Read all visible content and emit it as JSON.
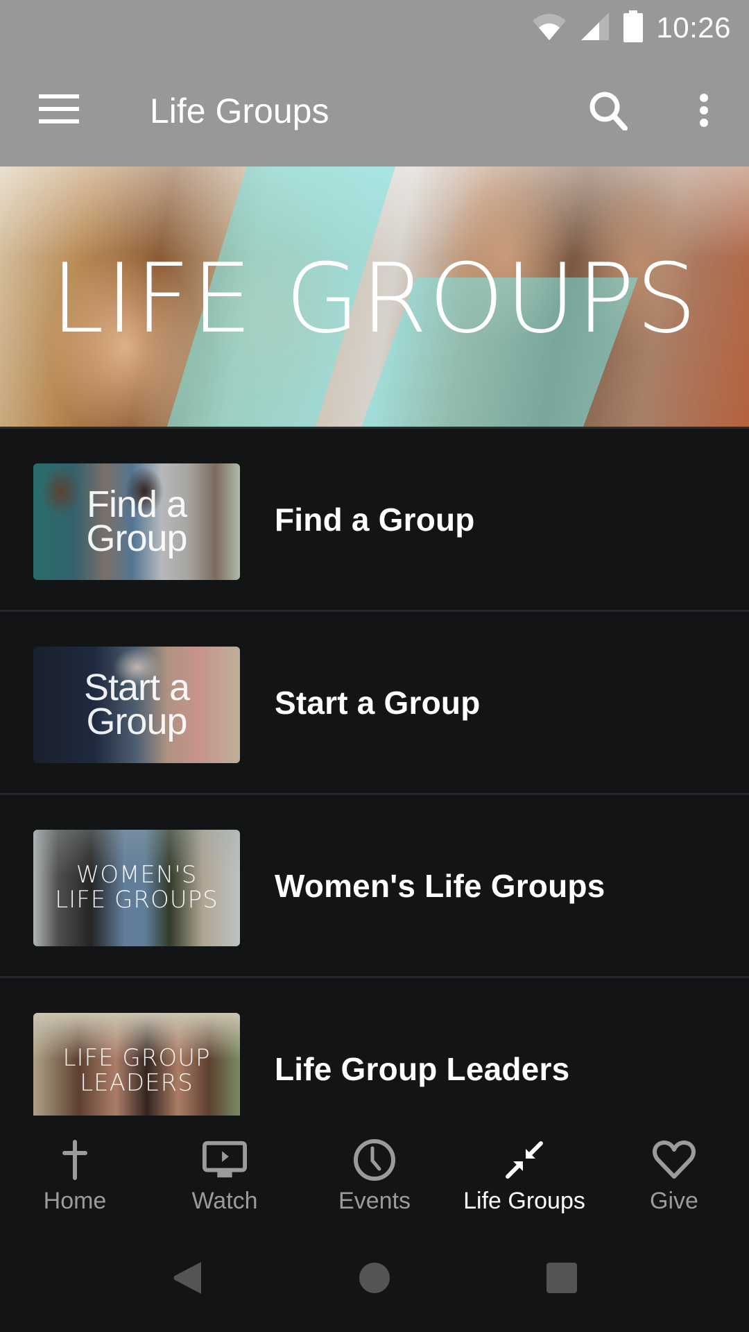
{
  "status_bar": {
    "time": "10:26",
    "icons": [
      "wifi-icon",
      "cellular-signal-icon",
      "battery-icon"
    ]
  },
  "app_bar": {
    "title": "Life Groups",
    "icons": {
      "menu": "hamburger-menu-icon",
      "search": "search-icon",
      "more": "more-vertical-icon"
    }
  },
  "hero": {
    "title": "LIFE GROUPS",
    "accent_color": "#78e6e6"
  },
  "list": {
    "items": [
      {
        "label": "Find a Group",
        "thumbnail_text_line1": "Find a",
        "thumbnail_text_line2": "Group"
      },
      {
        "label": "Start a Group",
        "thumbnail_text_line1": "Start a",
        "thumbnail_text_line2": "Group"
      },
      {
        "label": "Women's Life Groups",
        "thumbnail_text_line1": "WOMEN'S",
        "thumbnail_text_line2": "LIFE GROUPS"
      },
      {
        "label": "Life Group Leaders",
        "thumbnail_text_line1": "LIFE GROUP",
        "thumbnail_text_line2": "LEADERS"
      }
    ]
  },
  "bottom_nav": {
    "active_index": 3,
    "items": [
      {
        "label": "Home",
        "icon": "cross-icon"
      },
      {
        "label": "Watch",
        "icon": "tv-play-icon"
      },
      {
        "label": "Events",
        "icon": "clock-icon"
      },
      {
        "label": "Life Groups",
        "icon": "arrows-inward-icon"
      },
      {
        "label": "Give",
        "icon": "heart-icon"
      }
    ]
  },
  "system_nav": {
    "buttons": [
      "back",
      "home",
      "recents"
    ]
  },
  "colors": {
    "app_bar": "#97989a",
    "background": "#131416",
    "divider": "#26272a",
    "nav_inactive": "#9a9b9d",
    "nav_active": "#ffffff",
    "system_buttons": "#525456"
  }
}
